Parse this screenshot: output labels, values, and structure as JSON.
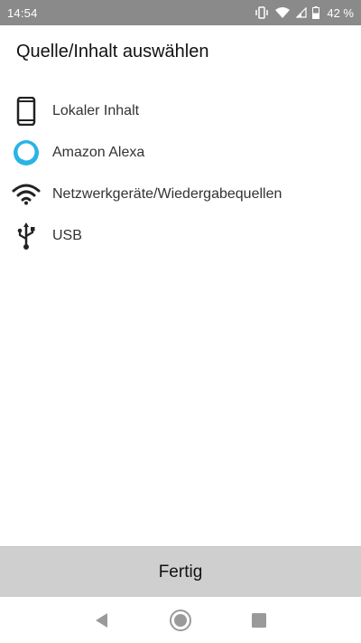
{
  "status_bar": {
    "time": "14:54",
    "battery": "42 %",
    "icons": [
      "vibrate-icon",
      "wifi-icon",
      "signal-icon",
      "battery-icon"
    ]
  },
  "title": "Quelle/Inhalt auswählen",
  "sources": [
    {
      "label": "Lokaler Inhalt",
      "icon": "phone-icon"
    },
    {
      "label": "Amazon Alexa",
      "icon": "alexa-icon"
    },
    {
      "label": "Netzwerkgeräte/Wiedergabequellen",
      "icon": "wifi-icon"
    },
    {
      "label": "USB",
      "icon": "usb-icon"
    }
  ],
  "done_label": "Fertig",
  "navigation": [
    "back-icon",
    "home-icon",
    "recents-icon"
  ],
  "colors": {
    "status_bar": "#8a8a8a",
    "alexa_accent": "#2ab4e4",
    "done_button": "#cfcfcf"
  }
}
